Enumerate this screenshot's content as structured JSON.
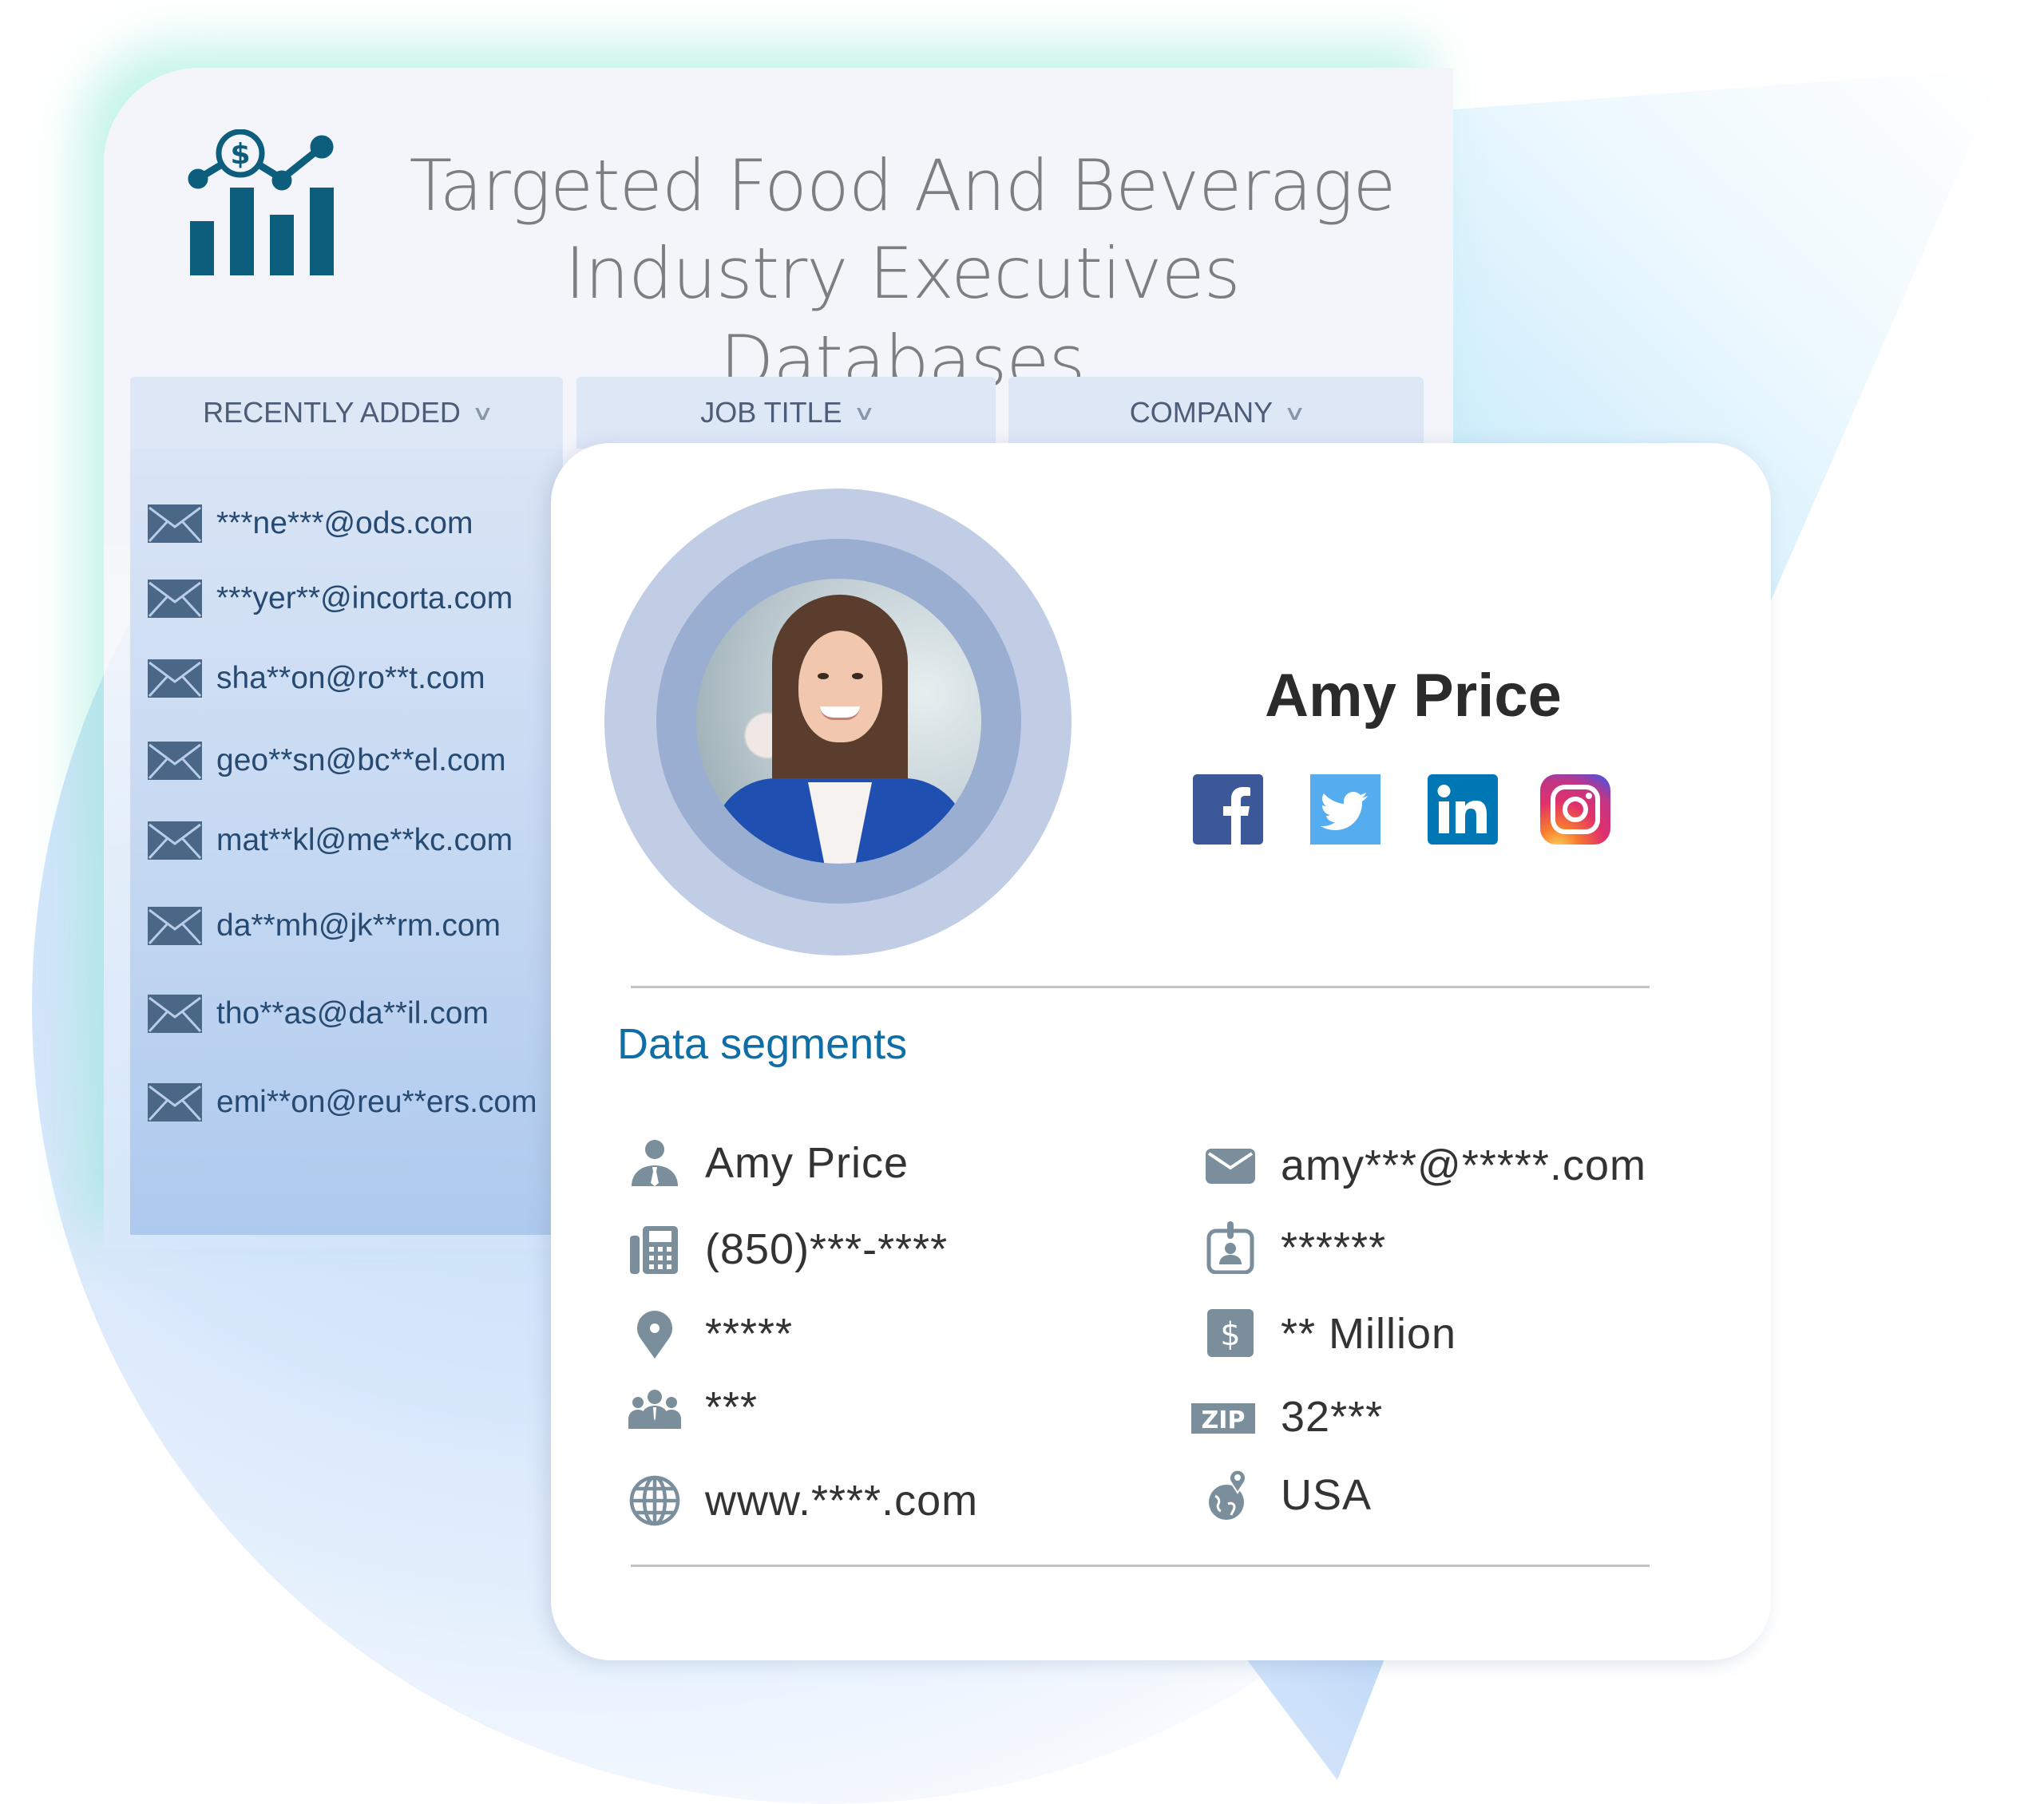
{
  "header": {
    "title_line1": "Targeted Food And Beverage",
    "title_line2": "Industry Executives Databases",
    "logo_icon": "chart-dollar-icon"
  },
  "tabs": [
    {
      "label": "RECENTLY ADDED",
      "icon": "chevron-down-icon"
    },
    {
      "label": "JOB TITLE",
      "icon": "chevron-down-icon"
    },
    {
      "label": "COMPANY",
      "icon": "chevron-down-icon"
    }
  ],
  "recent_emails": [
    "***ne***@ods.com",
    "***yer**@incorta.com",
    "sha**on@ro**t.com",
    "geo**sn@bc**el.com",
    "mat**kl@me**kc.com",
    "da**mh@jk**rm.com",
    "tho**as@da**il.com",
    "emi**on@reu**ers.com"
  ],
  "profile": {
    "name": "Amy Price",
    "social": [
      {
        "name": "facebook",
        "icon": "facebook-icon",
        "color": "#3b5998"
      },
      {
        "name": "twitter",
        "icon": "twitter-icon",
        "color": "#55acee"
      },
      {
        "name": "linkedin",
        "icon": "linkedin-icon",
        "color": "#0077b5"
      },
      {
        "name": "instagram",
        "icon": "instagram-icon",
        "color": "#c13584"
      }
    ]
  },
  "segments": {
    "title": "Data segments",
    "left": [
      {
        "icon": "person-icon",
        "value": "Amy Price"
      },
      {
        "icon": "phone-icon",
        "value": "(850)***-****"
      },
      {
        "icon": "location-pin-icon",
        "value": "*****"
      },
      {
        "icon": "group-icon",
        "value": "***"
      },
      {
        "icon": "globe-icon",
        "value": "www.****.com"
      }
    ],
    "right": [
      {
        "icon": "envelope-icon",
        "value": "amy***@*****.com"
      },
      {
        "icon": "id-badge-icon",
        "value": "******"
      },
      {
        "icon": "dollar-icon",
        "value": "** Million"
      },
      {
        "icon": "zip-icon",
        "value": "32***",
        "badge": "ZIP"
      },
      {
        "icon": "globe-pin-icon",
        "value": "USA"
      }
    ]
  },
  "colors": {
    "logo": "#0c5e7c",
    "accent_title": "#0f6ea5",
    "icon_gray": "#7a8e9b",
    "envelope": "#4a6788"
  }
}
